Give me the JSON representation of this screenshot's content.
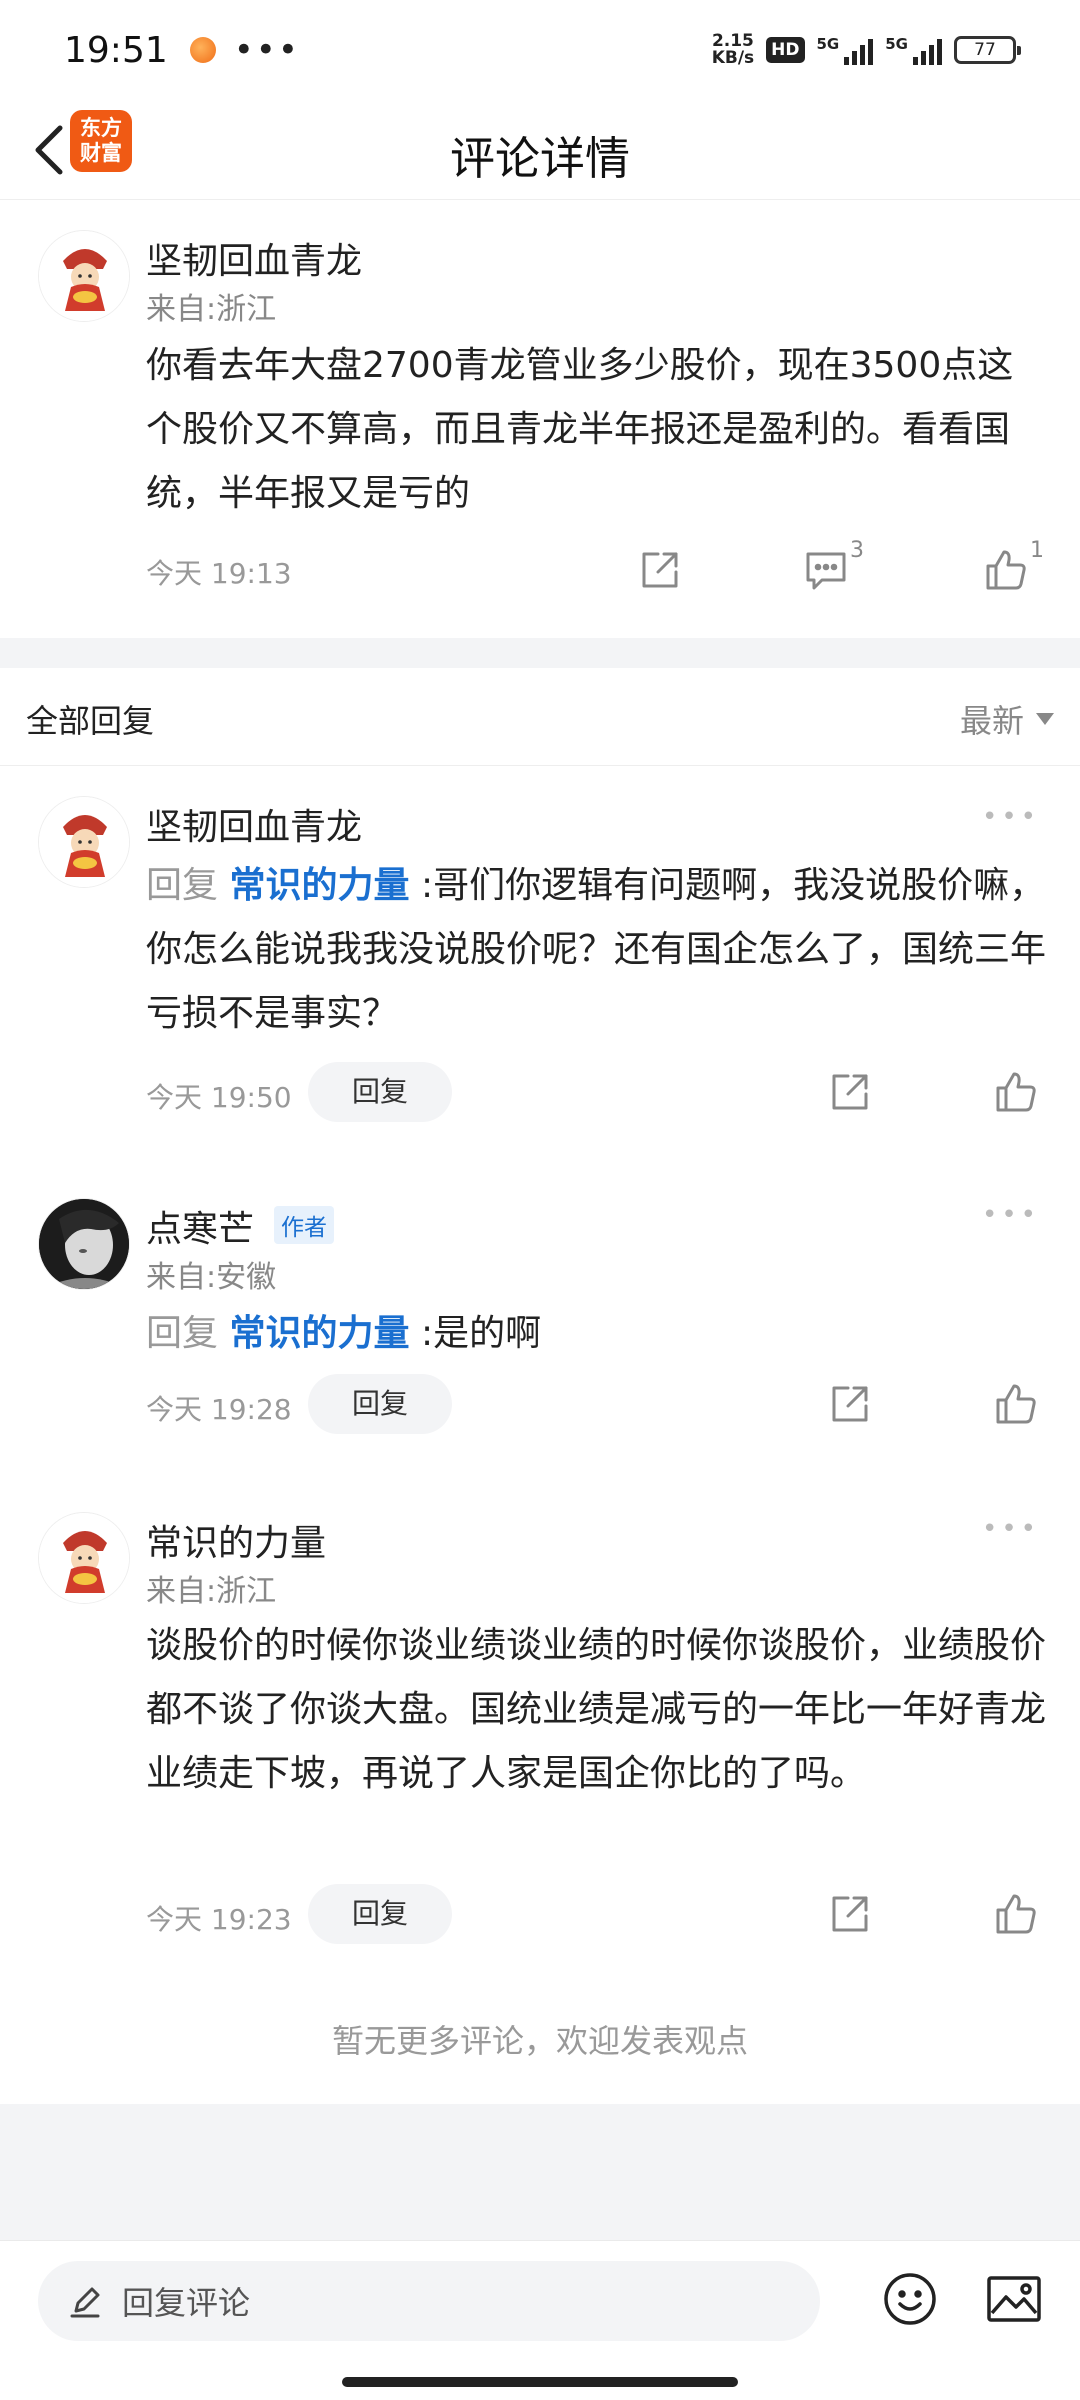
{
  "status": {
    "time": "19:51",
    "net_speed_value": "2.15",
    "net_speed_unit": "KB/s",
    "hd_label": "HD",
    "network_1": "5G",
    "network_2": "5G",
    "battery": "77"
  },
  "nav": {
    "title": "评论详情",
    "app_logo_line1": "东方",
    "app_logo_line2": "财富"
  },
  "main_comment": {
    "author": "坚韧回血青龙",
    "location": "来自:浙江",
    "text": "你看去年大盘2700青龙管业多少股价，现在3500点这个股价又不算高，而且青龙半年报还是盈利的。看看国统，半年报又是亏的",
    "time": "今天 19:13",
    "comment_count": "3",
    "like_count": "1"
  },
  "replies_section": {
    "title": "全部回复",
    "sort_label": "最新"
  },
  "replies": [
    {
      "author": "坚韧回血青龙",
      "reply_prefix": "回复",
      "reply_to": "常识的力量",
      "reply_sep": ":",
      "text": "哥们你逻辑有问题啊，我没说股价嘛，你怎么能说我我没说股价呢？还有国企怎么了，国统三年亏损不是事实？",
      "time": "今天 19:50",
      "reply_label": "回复"
    },
    {
      "author": "点寒芒",
      "author_tag": "作者",
      "location": "来自:安徽",
      "reply_prefix": "回复",
      "reply_to": "常识的力量",
      "reply_sep": ":",
      "text": "是的啊",
      "time": "今天 19:28",
      "reply_label": "回复"
    },
    {
      "author": "常识的力量",
      "location": "来自:浙江",
      "text": "谈股价的时候你谈业绩谈业绩的时候你谈股价，业绩股价都不谈了你谈大盘。国统业绩是减亏的一年比一年好青龙业绩走下坡，再说了人家是国企你比的了吗。",
      "time": "今天 19:23",
      "reply_label": "回复"
    }
  ],
  "footer": {
    "no_more": "暂无更多评论，欢迎发表观点",
    "input_placeholder": "回复评论"
  },
  "colors": {
    "accent_blue": "#1a6fd0",
    "brand_orange": "#f05a14",
    "muted_gray": "#999999"
  },
  "icons": [
    "back-arrow-icon",
    "share-icon",
    "comment-icon",
    "thumbs-up-icon",
    "more-dots-icon",
    "pencil-icon",
    "emoji-icon",
    "image-icon"
  ]
}
